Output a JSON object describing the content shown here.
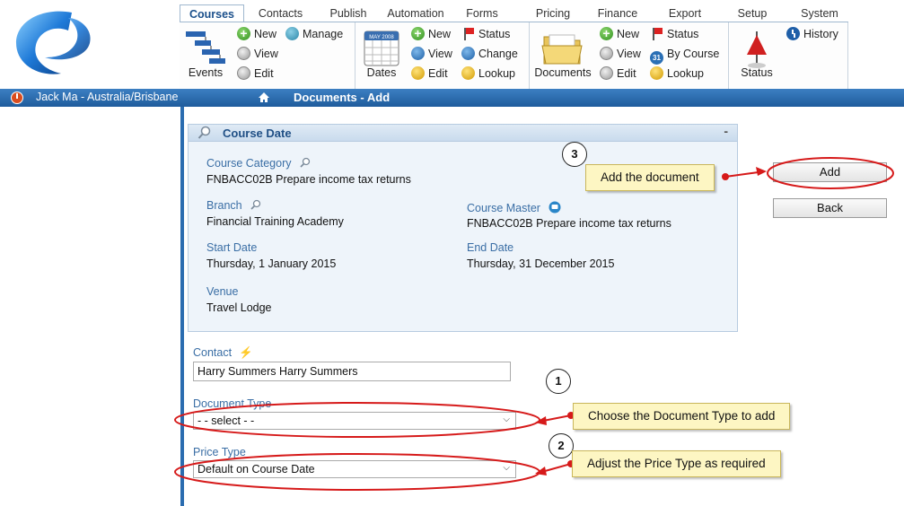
{
  "tabs": [
    "Courses",
    "Contacts",
    "Publish",
    "Automation",
    "Forms",
    "Pricing",
    "Finance",
    "Export",
    "Setup",
    "System"
  ],
  "ribbon": {
    "events_label": "Events",
    "events_new": "New",
    "events_manage": "Manage",
    "events_view": "View",
    "events_edit": "Edit",
    "dates_label": "Dates",
    "dates_calendar_month": "MAY 2008",
    "dates_new": "New",
    "dates_status": "Status",
    "dates_view": "View",
    "dates_change": "Change",
    "dates_edit": "Edit",
    "dates_lookup": "Lookup",
    "documents_label": "Documents",
    "documents_new": "New",
    "documents_status": "Status",
    "documents_view": "View",
    "documents_by_course": "By Course",
    "documents_calendar_day": "31",
    "documents_edit": "Edit",
    "documents_lookup": "Lookup",
    "status_label": "Status",
    "history": "History"
  },
  "bar": {
    "user": "Jack Ma - Australia/Brisbane",
    "title": "Documents - Add"
  },
  "panel": {
    "title": "Course Date",
    "collapse": "-",
    "course_category_label": "Course Category",
    "course_category_value": "FNBACC02B Prepare income tax returns",
    "branch_label": "Branch",
    "branch_value": "Financial Training Academy",
    "course_master_label": "Course Master",
    "course_master_value": "FNBACC02B Prepare income tax returns",
    "start_date_label": "Start Date",
    "start_date_value": "Thursday, 1 January 2015",
    "end_date_label": "End Date",
    "end_date_value": "Thursday, 31 December 2015",
    "venue_label": "Venue",
    "venue_value": "Travel Lodge"
  },
  "form": {
    "contact_label": "Contact",
    "contact_value": "Harry Summers Harry Summers",
    "document_type_label": "Document Type",
    "document_type_value": "- - select - -",
    "price_type_label": "Price Type",
    "price_type_value": "Default on Course Date"
  },
  "buttons": {
    "add": "Add",
    "back": "Back"
  },
  "callouts": {
    "step1_number": "1",
    "step1_text": "Choose the Document Type to add",
    "step2_number": "2",
    "step2_text": "Adjust the Price Type as required",
    "step3_number": "3",
    "step3_text": "Add the document"
  },
  "colors": {
    "status_bar": "#2a6cb0",
    "annotation_red": "#d61a1a",
    "callout_fill": "#fdf6c3",
    "label_blue": "#3a6ea5"
  }
}
